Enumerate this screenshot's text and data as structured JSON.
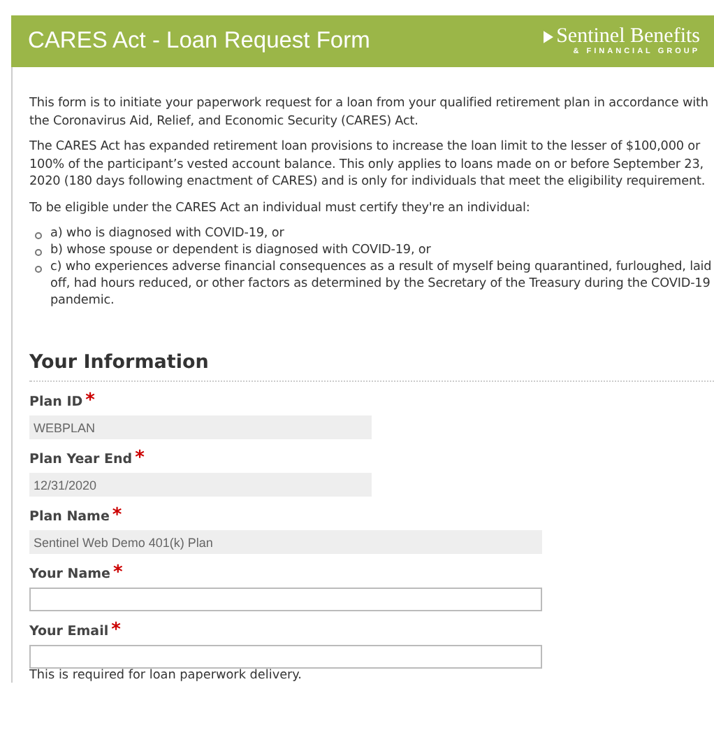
{
  "header": {
    "title": "CARES Act - Loan Request Form",
    "logo": {
      "name": "Sentinel Benefits",
      "tagline": "& FINANCIAL GROUP"
    }
  },
  "intro": [
    "This form is to initiate your paperwork request for a loan from your qualified retirement plan in accordance with the Coronavirus Aid, Relief, and Economic Security (CARES) Act.",
    "The CARES Act has expanded retirement loan provisions to increase the loan limit to the lesser of $100,000 or 100% of the participant’s vested account balance. This only applies to loans made on or before September 23, 2020 (180 days following enactment of CARES) and is only for individuals that meet the eligibility requirement.",
    "To be eligible under the CARES Act an individual must certify they're an individual:"
  ],
  "criteria": [
    "a) who is diagnosed with COVID-19, or",
    "b) whose spouse or dependent is diagnosed with COVID-19, or",
    "c) who experiences adverse financial consequences as a result of myself being quarantined, furloughed, laid off, had hours reduced, or other factors as determined by the Secretary of the Treasury during the COVID-19 pandemic."
  ],
  "section": {
    "heading": "Your Information",
    "fields": [
      {
        "label": "Plan ID",
        "required_mark": "*",
        "value": "WEBPLAN",
        "disabled": true,
        "kind": "compact"
      },
      {
        "label": "Plan Year End",
        "required_mark": "*",
        "value": "12/31/2020",
        "disabled": true,
        "kind": "compact"
      },
      {
        "label": "Plan Name",
        "required_mark": "*",
        "value": "Sentinel Web Demo 401(k) Plan",
        "disabled": true,
        "kind": "wide"
      },
      {
        "label": "Your Name",
        "required_mark": "*",
        "disabled": false,
        "kind": "wide"
      },
      {
        "label": "Your Email",
        "required_mark": "*",
        "disabled": false,
        "kind": "wide",
        "note": "This is required for loan paperwork delivery."
      }
    ]
  }
}
